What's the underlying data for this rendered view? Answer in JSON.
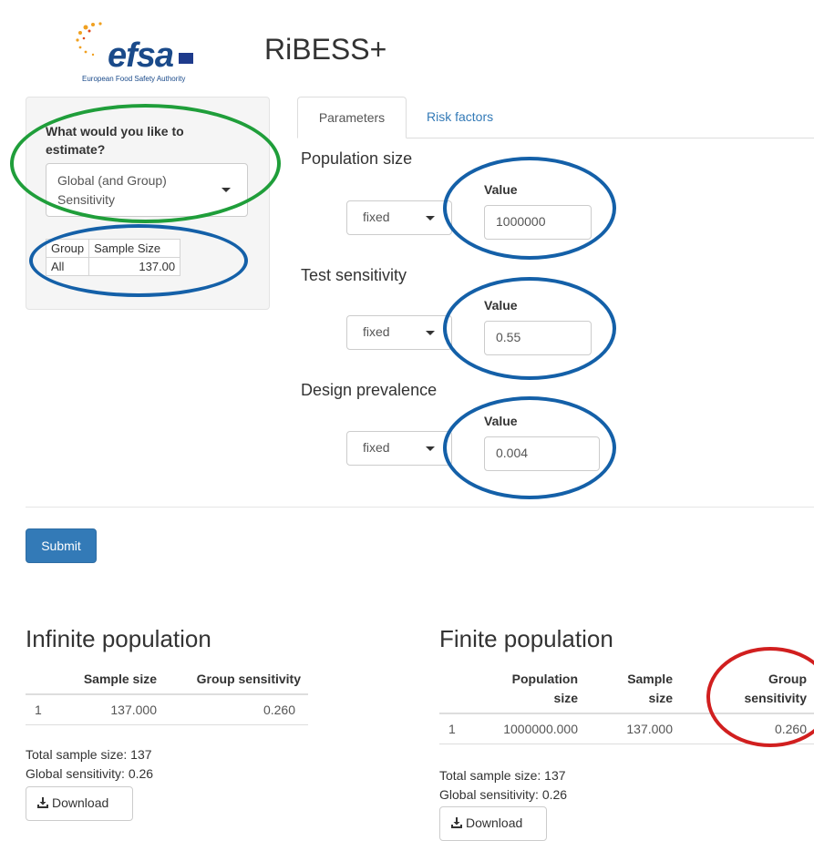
{
  "header": {
    "logo_word": "efsa",
    "logo_tagline": "European Food Safety Authority",
    "app_title": "RiBESS+"
  },
  "sidebar": {
    "question": "What would you like to estimate?",
    "estimate_select": "Global (and Group) Sensitivity",
    "group_table": {
      "headers": [
        "Group",
        "Sample Size"
      ],
      "rows": [
        [
          "All",
          "137.00"
        ]
      ]
    }
  },
  "tabs": [
    {
      "label": "Parameters",
      "active": true
    },
    {
      "label": "Risk factors",
      "active": false
    }
  ],
  "parameters": [
    {
      "label": "Population size",
      "mode": "fixed",
      "value_label": "Value",
      "value": "1000000"
    },
    {
      "label": "Test sensitivity",
      "mode": "fixed",
      "value_label": "Value",
      "value": "0.55"
    },
    {
      "label": "Design prevalence",
      "mode": "fixed",
      "value_label": "Value",
      "value": "0.004"
    }
  ],
  "submit_label": "Submit",
  "infinite": {
    "title": "Infinite population",
    "headers": [
      "",
      "Sample size",
      "Group sensitivity"
    ],
    "rows": [
      [
        "1",
        "137.000",
        "0.260"
      ]
    ],
    "total_sample": "Total sample size: 137",
    "global_sensitivity": "Global sensitivity: 0.26",
    "download_label": "Download"
  },
  "finite": {
    "title": "Finite population",
    "headers": [
      "",
      "Population size",
      "Sample size",
      "Group sensitivity"
    ],
    "rows": [
      [
        "1",
        "1000000.000",
        "137.000",
        "0.260"
      ]
    ],
    "total_sample": "Total sample size: 137",
    "global_sensitivity": "Global sensitivity: 0.26",
    "download_label": "Download"
  },
  "colors": {
    "primary": "#337ab7",
    "ring_green": "#1f9e3a",
    "ring_blue": "#1460a8",
    "ring_red": "#d11f1f",
    "efsa_blue": "#1a4a8a",
    "efsa_star": "#f0a020"
  },
  "icons": {
    "select_caret": "caret-down",
    "download": "download-icon"
  }
}
